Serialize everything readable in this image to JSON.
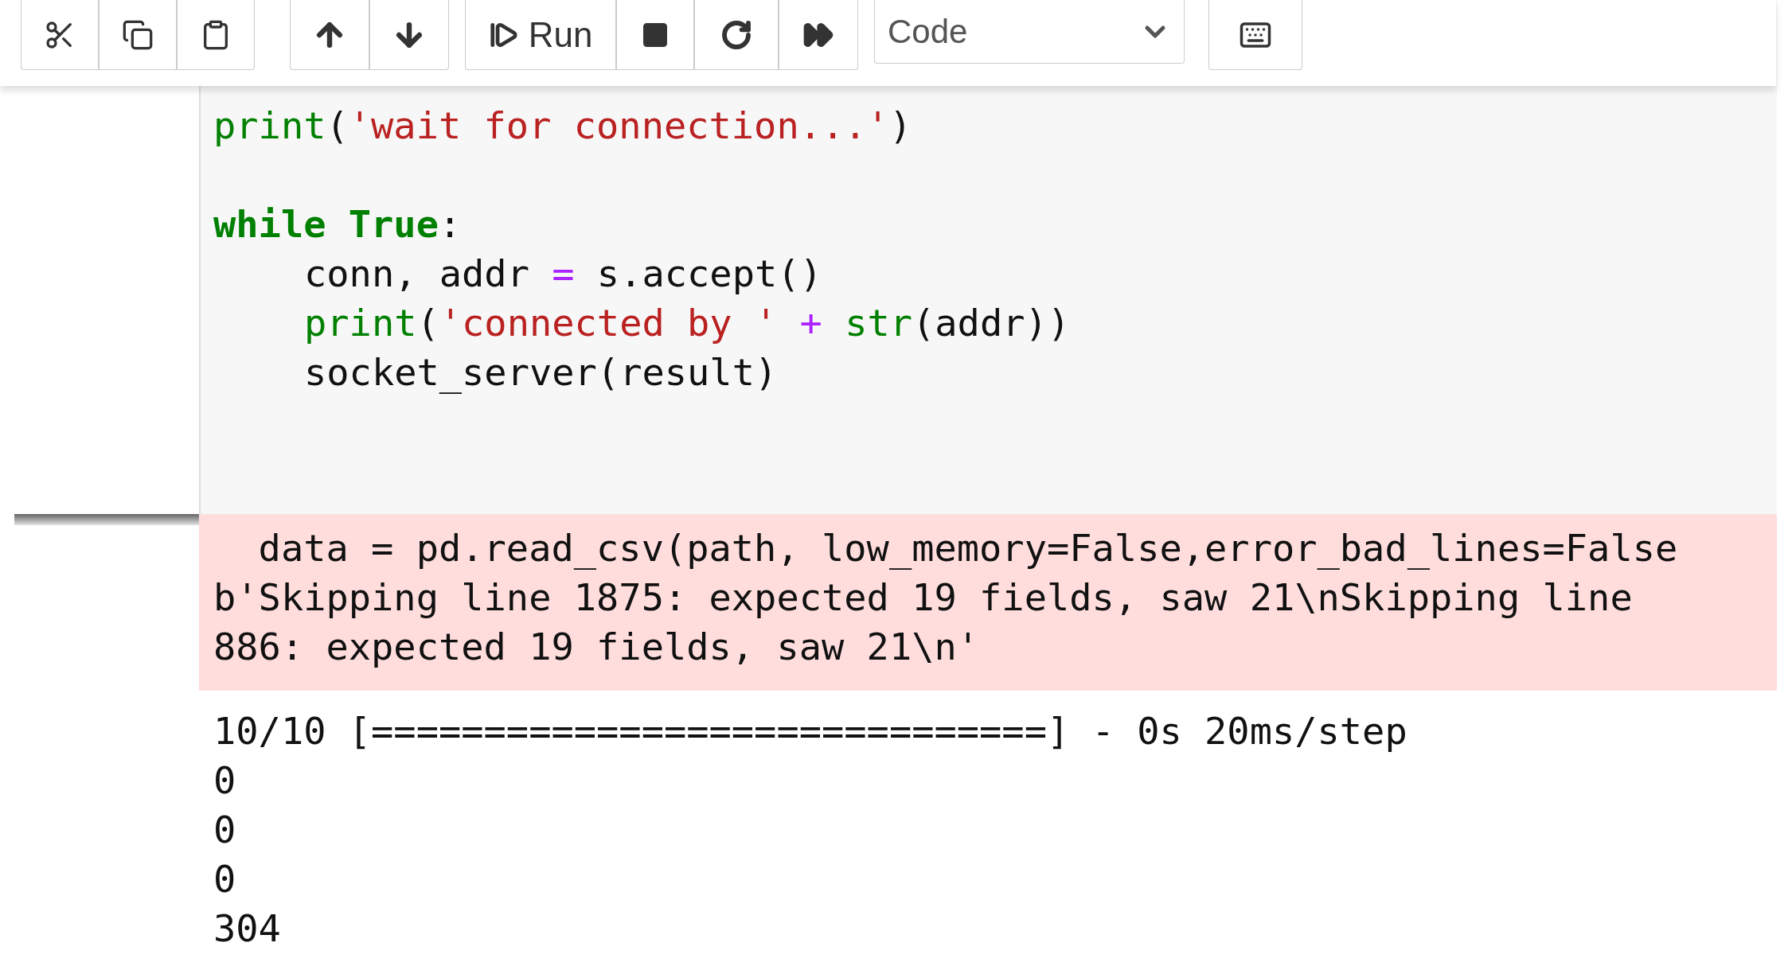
{
  "toolbar": {
    "run_button": {
      "label": "Run"
    },
    "cell_type_select": {
      "value": "Code"
    }
  },
  "code_cell": {
    "lines": [
      {
        "tokens": [
          {
            "kind": "builtin",
            "text": "print"
          },
          {
            "kind": "plain",
            "text": "("
          },
          {
            "kind": "string",
            "text": "'wait for connection...'"
          },
          {
            "kind": "plain",
            "text": ")"
          }
        ]
      },
      {
        "kind": "blank"
      },
      {
        "tokens": [
          {
            "kind": "keyword",
            "text": "while "
          },
          {
            "kind": "keyword",
            "text": "True"
          },
          {
            "kind": "plain",
            "text": ":"
          }
        ],
        "children": [
          {
            "tokens": [
              {
                "kind": "plain",
                "text": "conn, addr "
              },
              {
                "kind": "operator",
                "text": "="
              },
              {
                "kind": "plain",
                "text": " s.accept()"
              }
            ]
          },
          {
            "tokens": [
              {
                "kind": "builtin",
                "text": "print"
              },
              {
                "kind": "plain",
                "text": "("
              },
              {
                "kind": "string",
                "text": "'connected by '"
              },
              {
                "kind": "operator",
                "text": " + "
              },
              {
                "kind": "builtin",
                "text": "str"
              },
              {
                "kind": "plain",
                "text": "(addr))"
              }
            ]
          },
          {
            "tokens": [
              {
                "kind": "plain",
                "text": "socket_server(result)"
              }
            ]
          }
        ]
      }
    ]
  },
  "stderr_output": {
    "lines": [
      "  data = pd.read_csv(path, low_memory=False,error_bad_lines=False",
      "b'Skipping line 1875: expected 19 fields, saw 21\\nSkipping line",
      "886: expected 19 fields, saw 21\\n'"
    ]
  },
  "stdout_output": {
    "lines": [
      "10/10 [==============================] - 0s 20ms/step",
      "0",
      "0",
      "0",
      "304"
    ]
  }
}
